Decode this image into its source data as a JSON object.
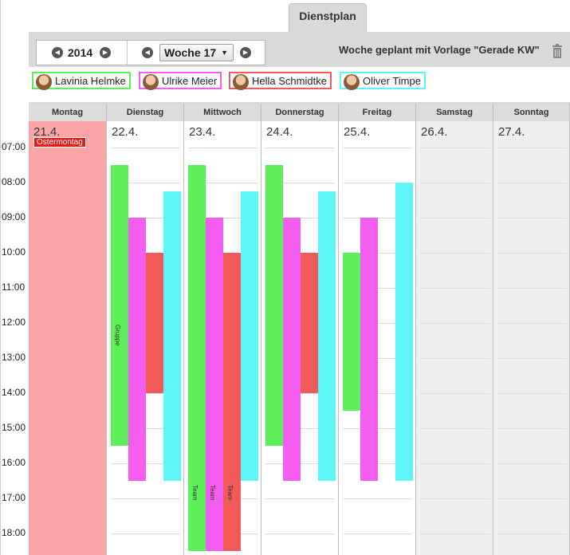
{
  "tab": {
    "label": "Dienstplan"
  },
  "controls": {
    "year": "2014",
    "week": "Woche 17",
    "template_text": "Woche geplant mit Vorlage \"Gerade KW\""
  },
  "persons": [
    {
      "name": "Lavinia Helmke",
      "color": "#5ef05a"
    },
    {
      "name": "Ulrike Meier",
      "color": "#f55cf0"
    },
    {
      "name": "Hella Schmidtke",
      "color": "#f25a59"
    },
    {
      "name": "Oliver Timpe",
      "color": "#5cf5f8"
    }
  ],
  "days": [
    {
      "name": "Montag",
      "date": "21.4.",
      "holiday": "Ostermontag"
    },
    {
      "name": "Dienstag",
      "date": "22.4."
    },
    {
      "name": "Mittwoch",
      "date": "23.4."
    },
    {
      "name": "Donnerstag",
      "date": "24.4."
    },
    {
      "name": "Freitag",
      "date": "25.4."
    },
    {
      "name": "Samstag",
      "date": "26.4."
    },
    {
      "name": "Sonntag",
      "date": "27.4."
    }
  ],
  "times": [
    "07:00",
    "08:00",
    "09:00",
    "10:00",
    "11:00",
    "12:00",
    "13:00",
    "14:00",
    "15:00",
    "16:00",
    "17:00",
    "18:00"
  ],
  "shift_labels": {
    "gruppe": "Gruppe",
    "team": "Team"
  }
}
